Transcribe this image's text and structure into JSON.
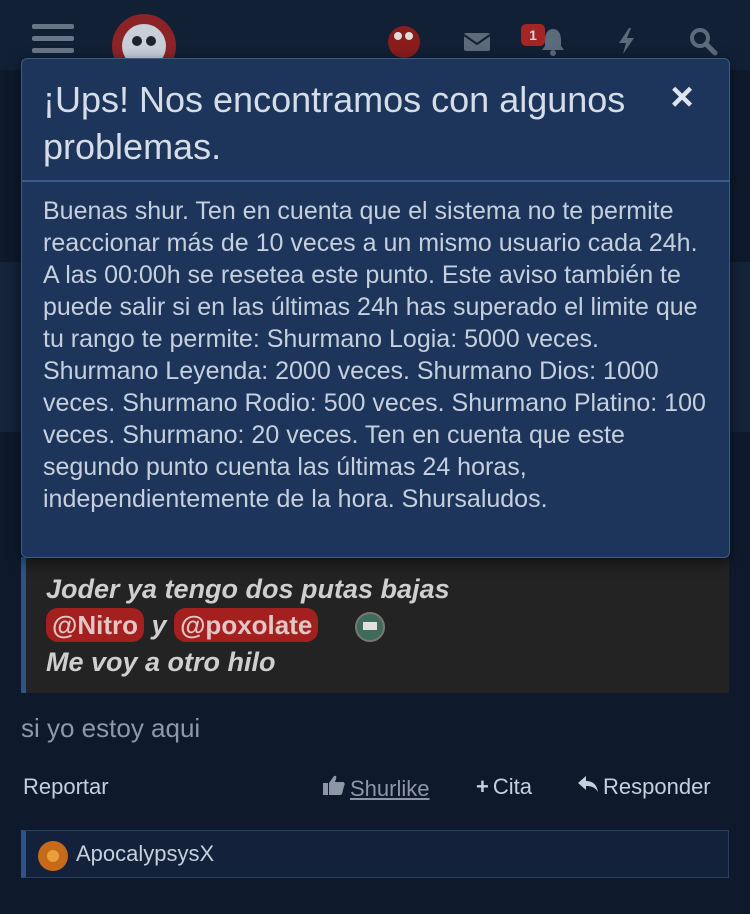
{
  "header": {
    "notification_count": "1",
    "icons": [
      "menu-icon",
      "site-logo",
      "user-avatar",
      "mail-icon",
      "bell-icon",
      "lightning-icon",
      "search-icon"
    ]
  },
  "modal": {
    "title": "¡Ups! Nos encontramos con algunos problemas.",
    "close_label": "×",
    "message": "Buenas shur. Ten en cuenta que el sistema no te permite reaccionar más de 10 veces a un mismo usuario cada 24h. A las 00:00h se resetea este punto. Este aviso también te puede salir si en las últimas 24h has superado el limite que tu rango te permite: Shurmano Logia: 5000 veces. Shurmano Leyenda: 2000 veces. Shurmano Dios: 1000 veces. Shurmano Rodio: 500 veces. Shurmano Platino: 100 veces. Shurmano: 20 veces. Ten en cuenta que este segundo punto cuenta las últimas 24 horas, independientemente de la hora. Shursaludos."
  },
  "quote": {
    "line1": "Joder ya tengo dos putas bajas",
    "mention1": "@Nitro",
    "connector": "y",
    "mention2": "@poxolate",
    "line3": "Me voy a otro hilo"
  },
  "post": {
    "text": "si yo estoy aqui"
  },
  "actions": {
    "report": "Reportar",
    "like": "Shurlike",
    "quote": "Cita",
    "reply": "Responder"
  },
  "reactors": {
    "name": "ApocalypsysX"
  }
}
